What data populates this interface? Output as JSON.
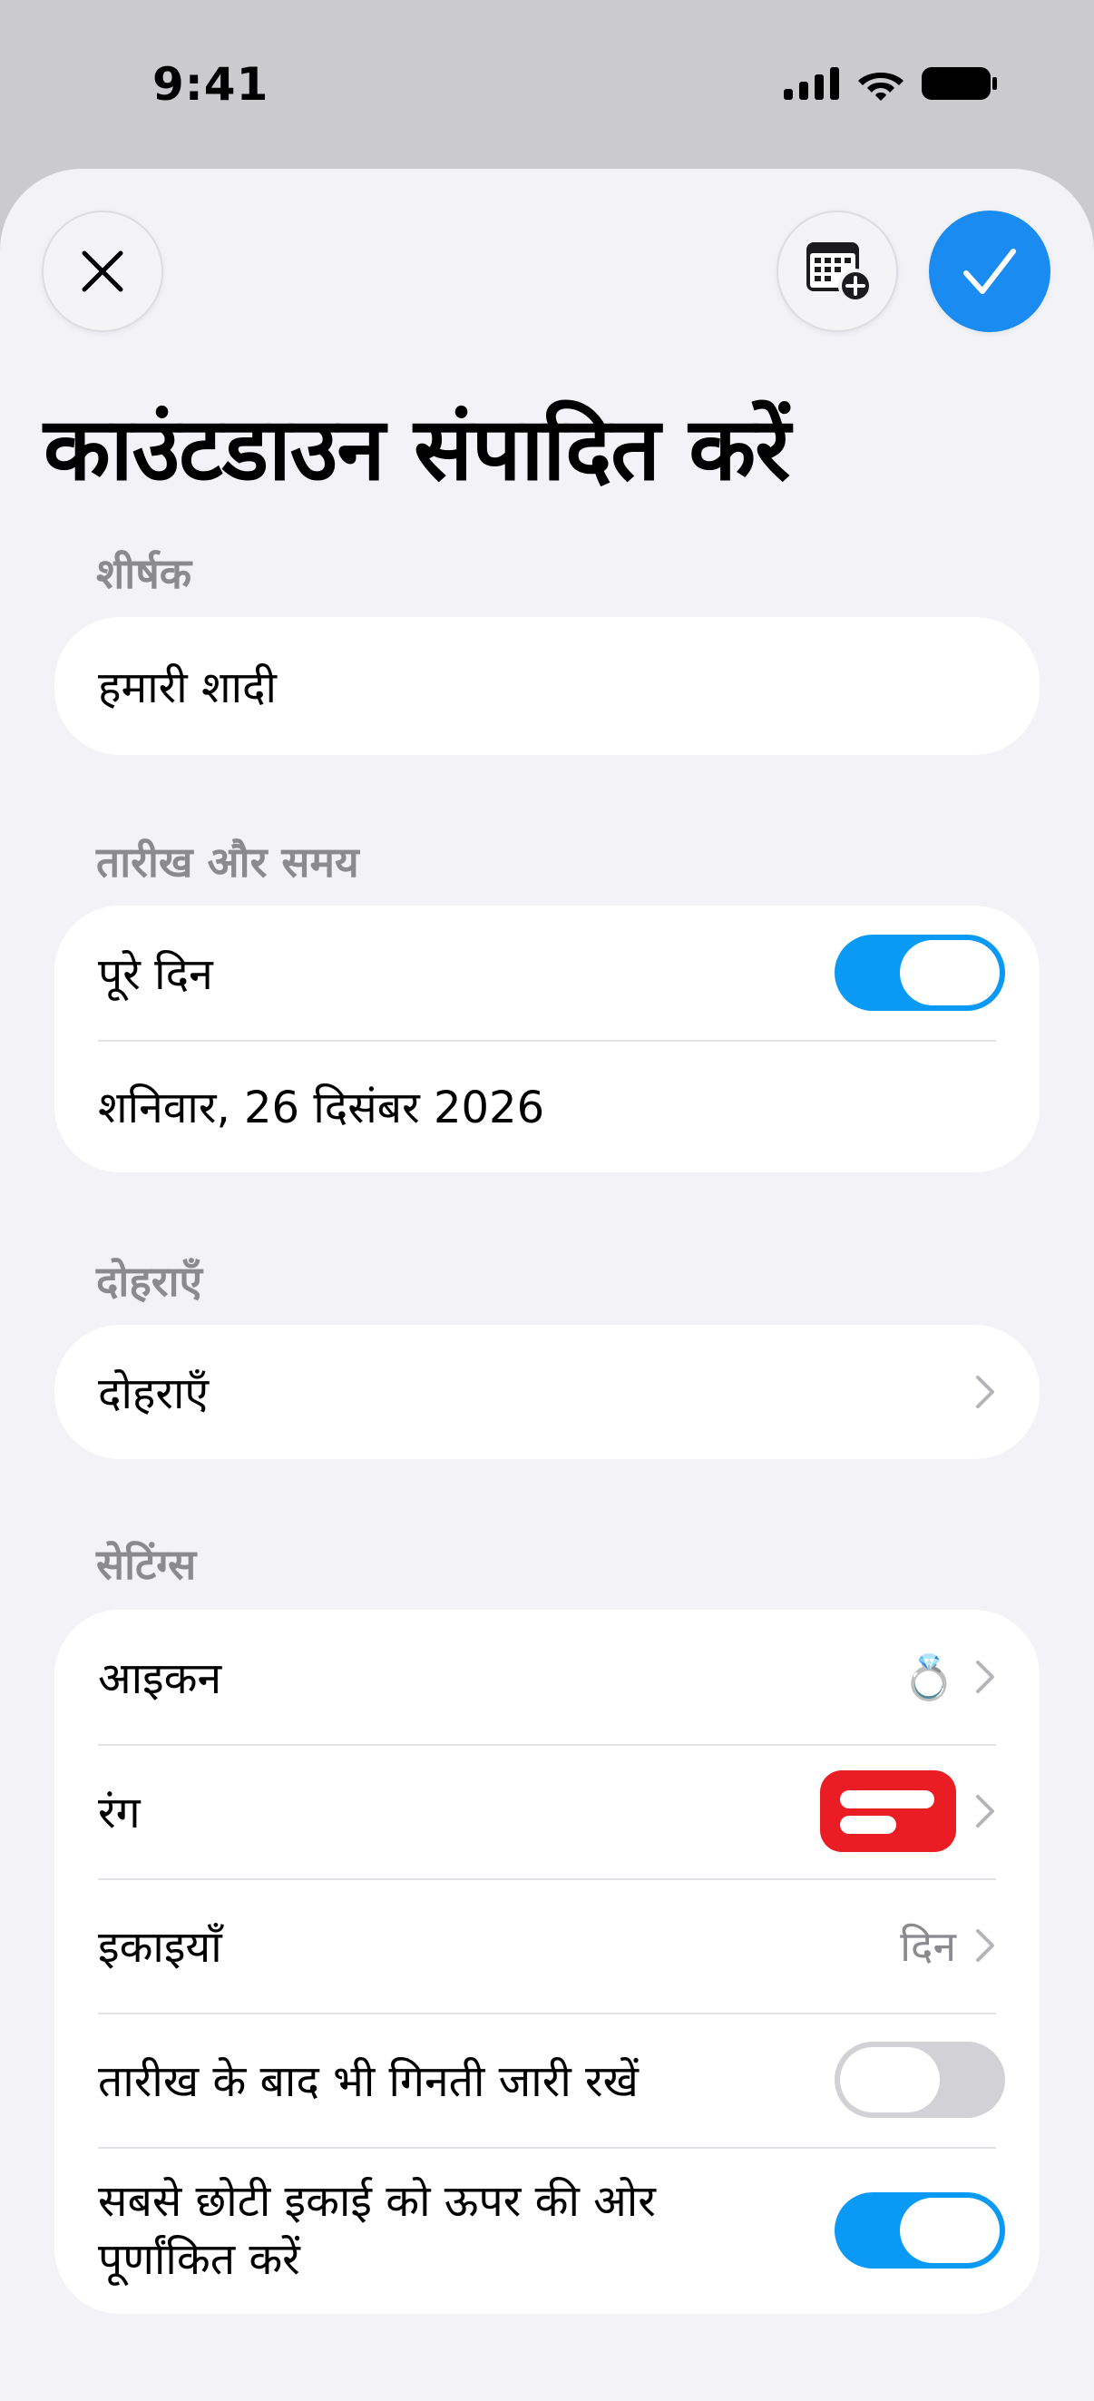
{
  "status_bar": {
    "time": "9:41"
  },
  "header": {
    "title": "काउंटडाउन संपादित करें",
    "accent_color": "#1a8bf0"
  },
  "sections": {
    "title_label": "शीर्षक",
    "title_value": "हमारी शादी",
    "datetime_label": "तारीख और समय",
    "all_day_label": "पूरे दिन",
    "all_day_on": true,
    "date_value": "शनिवार, 26 दिसंबर 2026",
    "repeat_label": "दोहराएँ",
    "repeat_row_label": "दोहराएँ",
    "settings_label": "सेटिंग्स",
    "icon_label": "आइकन",
    "icon_value": "💍",
    "color_label": "रंग",
    "color_value": "#ea1c24",
    "units_label": "इकाइयाँ",
    "units_value": "दिन",
    "continue_label": "तारीख के बाद भी गिनती जारी रखें",
    "continue_on": false,
    "round_label": "सबसे छोटी इकाई को ऊपर की ओर पूर्णांकित करें",
    "round_on": true
  }
}
